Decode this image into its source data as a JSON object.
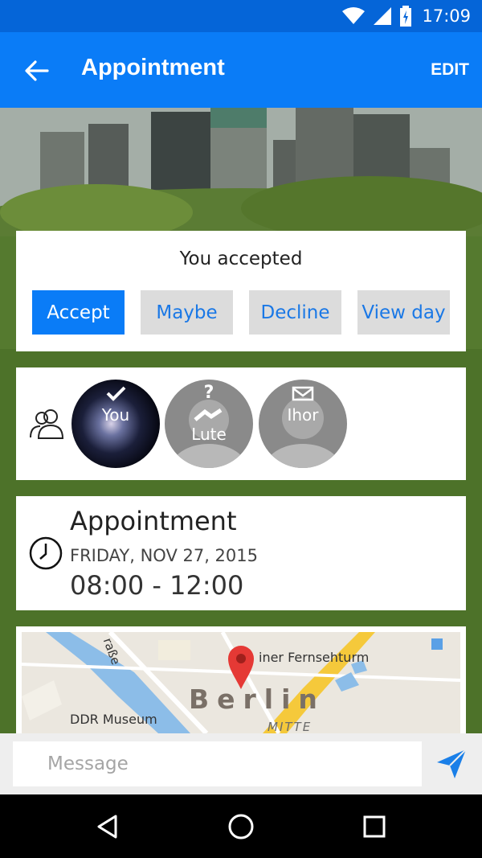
{
  "status_bar": {
    "time": "17:09",
    "icons": [
      "wifi-icon",
      "signal-icon",
      "battery-charging-icon"
    ]
  },
  "app_bar": {
    "title": "Appointment",
    "back_icon": "arrow-left-icon",
    "edit_label": "EDIT"
  },
  "rsvp": {
    "status": "You accepted",
    "buttons": [
      {
        "label": "Accept",
        "active": true
      },
      {
        "label": "Maybe",
        "active": false
      },
      {
        "label": "Decline",
        "active": false
      },
      {
        "label": "View day",
        "active": false
      }
    ]
  },
  "attendees": {
    "icon": "people-icon",
    "list": [
      {
        "name": "You",
        "status_icon": "checkmark-icon"
      },
      {
        "name": "Lute",
        "status_icon": "question-icon"
      },
      {
        "name": "Ihor",
        "status_icon": "envelope-icon"
      }
    ]
  },
  "event": {
    "icon": "clock-icon",
    "title": "Appointment",
    "date": "FRIDAY, NOV 27, 2015",
    "time": "08:00 - 12:00"
  },
  "map": {
    "labels": {
      "street": "raße",
      "tower": "iner Fernsehturm",
      "city": "Berlin",
      "museum": "DDR Museum",
      "district": "MITTE"
    }
  },
  "message": {
    "placeholder": "Message",
    "send_icon": "send-icon"
  },
  "nav_bar": {
    "icons": [
      "back-triangle-icon",
      "home-circle-icon",
      "recents-square-icon"
    ]
  },
  "colors": {
    "primary": "#0a7cf7",
    "status_bar": "#0565d8",
    "button_bg": "#dcdcdc",
    "map_pin": "#e53935"
  }
}
